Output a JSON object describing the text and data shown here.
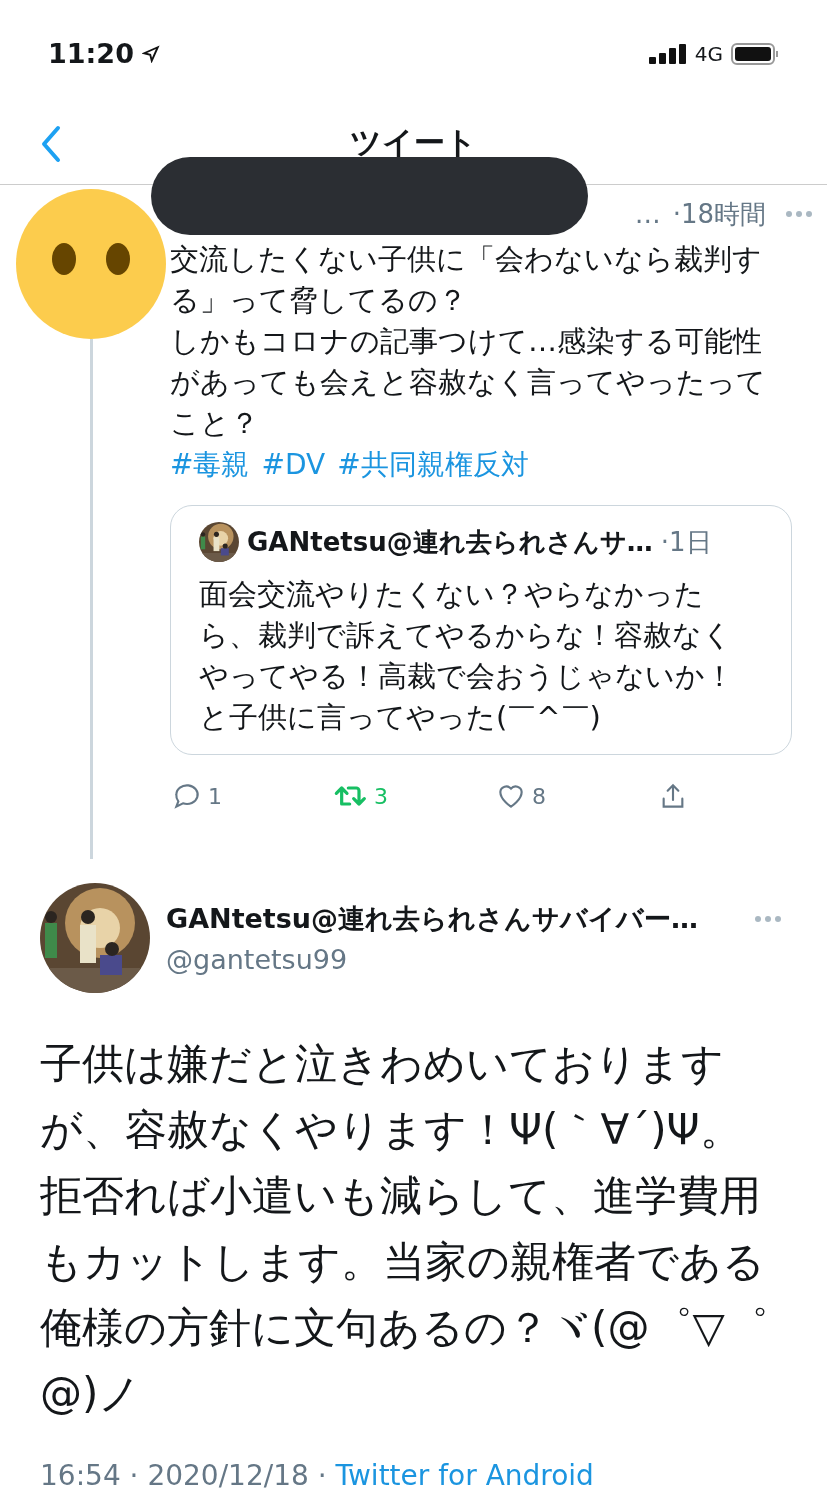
{
  "status_bar": {
    "time": "11:20",
    "network": "4G"
  },
  "nav": {
    "title": "ツイート"
  },
  "parent_tweet": {
    "author_fragment": "…",
    "time": "·18時間",
    "redacted": true,
    "paragraphs": [
      "交流したくない子供に「会わないなら裁判する」って脅してるの？",
      "しかもコロナの記事つけて…感染する可能性があっても会えと容赦なく言ってやったってこと？"
    ],
    "hashtags": [
      "#毒親",
      "#DV",
      "#共同親権反対"
    ],
    "quote": {
      "name": "GANtetsu@連れ去られさんサ…",
      "time": "·1日",
      "text": "面会交流やりたくない？やらなかったら、裁判で訴えてやるからな！容赦なくやってやる！高裁で会おうじゃないか！と子供に言ってやった(￣^￣)"
    },
    "actions": [
      {
        "kind": "reply",
        "count": "1",
        "active": false
      },
      {
        "kind": "retweet",
        "count": "3",
        "active": true
      },
      {
        "kind": "like",
        "count": "8",
        "active": false
      },
      {
        "kind": "share",
        "active": false
      }
    ]
  },
  "main_tweet": {
    "name": "GANtetsu@連れ去られさんサバイバー…",
    "handle": "@gantetsu99",
    "text": "子供は嫌だと泣きわめいておりますが、容赦なくやります！Ψ(｀∀´)Ψ。拒否れば小遣いも減らして、進学費用もカットします。当家の親権者である俺様の方針に文句あるの？ヾ(@゜▽゜@)ノ",
    "timestamp": "16:54 · 2020/12/18 · ",
    "source": "Twitter for Android"
  }
}
